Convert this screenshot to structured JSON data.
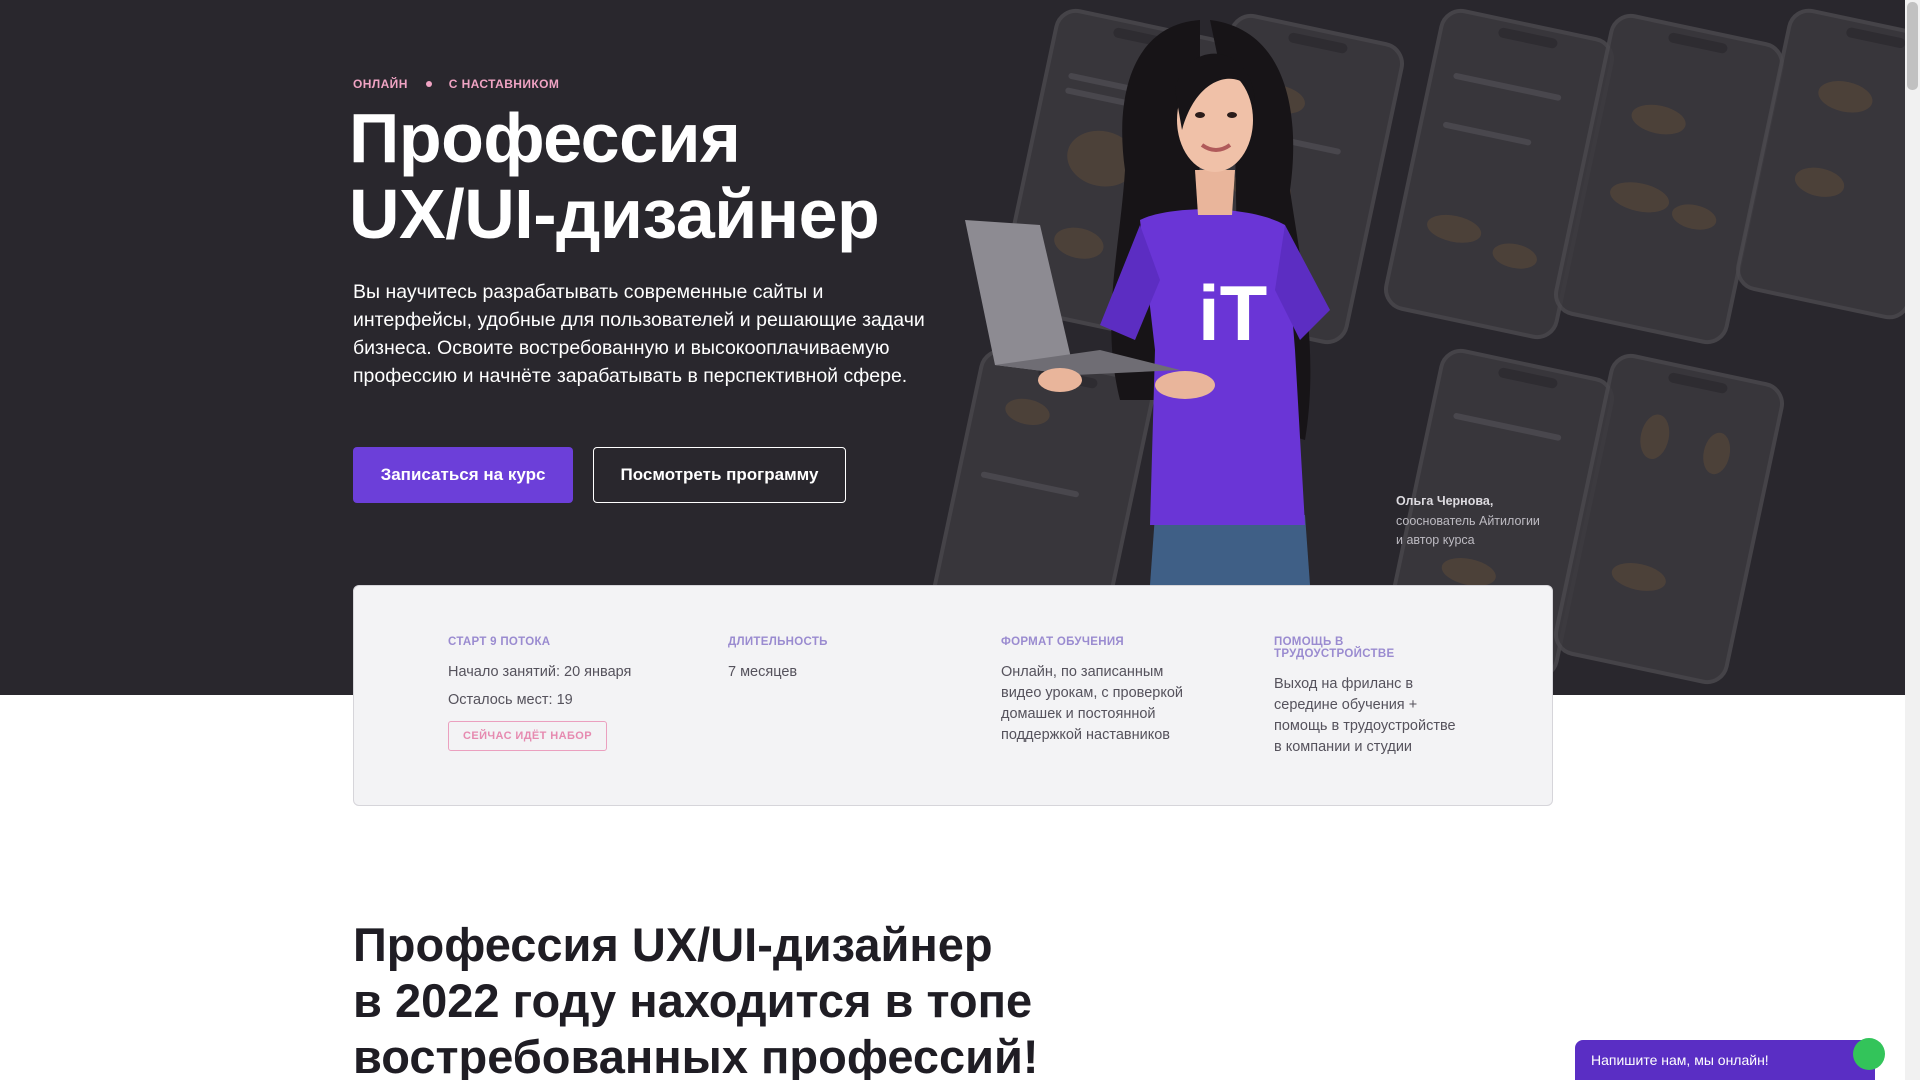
{
  "hero": {
    "tags": [
      "ОНЛАЙН",
      "С НАСТАВНИКОМ"
    ],
    "title_line1": "Профессия",
    "title_line2": "UX/UI-дизайнер",
    "subtitle": "Вы научитесь разрабатывать современные сайты и интерфейсы, удобные для пользователей и решающие задачи бизнеса. Освоите востребованную и высокооплачиваемую профессию и начнёте зарабатывать в перспективной сфере.",
    "primary_button": "Записаться на курс",
    "secondary_button": "Посмотреть программу",
    "author_name": "Ольга Чернова,",
    "author_role_line1": "сооснователь Айтилогии",
    "author_role_line2": "и автор курса"
  },
  "info": {
    "start_label": "СТАРТ 9 ПОТОКА",
    "start_date": "Начало занятий: 20 января",
    "seats": "Осталось мест: 19",
    "status_badge": "СЕЙЧАС ИДЁТ НАБОР",
    "duration_label": "ДЛИТЕЛЬНОСТЬ",
    "duration_value": "7 месяцев",
    "format_label": "ФОРМАТ ОБУЧЕНИЯ",
    "format_value": "Онлайн, по записанным видео урокам, с проверкой домашек и постоянной поддержкой наставников",
    "job_label": "ПОМОЩЬ В ТРУДОУСТРОЙСТВЕ",
    "job_value": "Выход на фриланс в середине обучения + помощь в трудоустройстве в компании и студии"
  },
  "section": {
    "title_line1": "Профессия UX/UI-дизайнер",
    "title_line2": "в 2022 году находится в топе",
    "title_line3": "востребованных профессий!"
  },
  "chat": {
    "label": "Напишите нам, мы онлайн!"
  },
  "shirt_text": "iT",
  "colors": {
    "hero_bg": "#29272d",
    "accent": "#6c3fd9",
    "tag_pink": "#f0a3c3",
    "chat_bg": "#5a2ec4",
    "online_green": "#33c45a"
  },
  "icons": [
    "phone-mockup-image",
    "instructor-photo"
  ]
}
